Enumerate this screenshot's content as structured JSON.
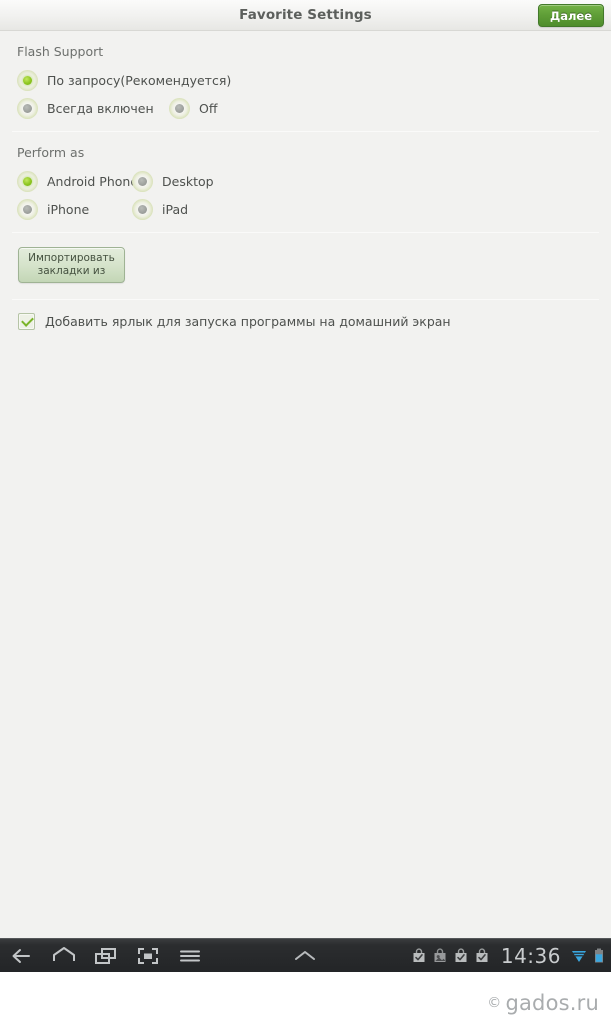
{
  "titlebar": {
    "title": "Favorite Settings",
    "next_label": "Далее"
  },
  "sections": {
    "flash": {
      "label": "Flash Support",
      "options": [
        {
          "label": "По запросу(Рекомендуется)",
          "selected": true
        },
        {
          "label": "Всегда включен",
          "selected": false
        },
        {
          "label": "Off",
          "selected": false
        }
      ]
    },
    "perform": {
      "label": "Perform as",
      "options": [
        {
          "label": "Android Phone",
          "selected": true
        },
        {
          "label": "Desktop",
          "selected": false
        },
        {
          "label": "iPhone",
          "selected": false
        },
        {
          "label": "iPad",
          "selected": false
        }
      ]
    }
  },
  "import_button": {
    "line1": "Импортировать",
    "line2": "закладки из"
  },
  "shortcut_checkbox": {
    "label": "Добавить ярлык для запуска программы на домашний экран",
    "checked": true
  },
  "navbar": {
    "icons": [
      "back-icon",
      "home-icon",
      "recent-apps-icon",
      "screenshot-icon",
      "menu-icon"
    ],
    "chevron": "chevron-up-icon",
    "status_icons": [
      "download-complete-icon",
      "download-image-icon",
      "download-complete-icon",
      "download-complete-icon"
    ],
    "clock": "14:36",
    "wifi": "wifi-icon",
    "battery": "battery-icon"
  },
  "watermark": {
    "copyright": "©",
    "text": "gados.ru"
  },
  "colors": {
    "accent_green": "#8dc61f",
    "button_green": "#5f9e37",
    "page_bg": "#f2f2f0",
    "navbar_bg": "#2b2d2f",
    "status_blue": "#3aa7e0"
  }
}
